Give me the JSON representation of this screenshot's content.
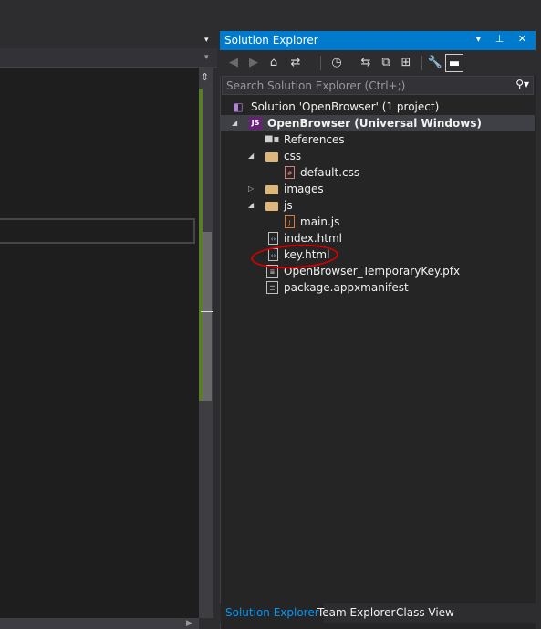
{
  "editor": {
    "top_dropdown_arrow": "▾",
    "nav_dropdown_arrow": "▾",
    "split_handle_glyph": "⇕",
    "hscroll_arrow": "▶"
  },
  "solution_explorer": {
    "title": "Solution Explorer",
    "title_buttons": "▾ ⊥ ✕",
    "toolbar": {
      "back": "◀",
      "forward": "▶",
      "home": "⌂",
      "sync": "⇄",
      "pending": "◷",
      "refresh": "⇆",
      "collapse": "⧉",
      "show_all": "⊞",
      "properties": "🔧",
      "preview": "▬"
    },
    "search": {
      "placeholder": "Search Solution Explorer (Ctrl+;)",
      "icon": "⚲▾"
    },
    "tree": {
      "solution": "Solution 'OpenBrowser' (1 project)",
      "project": "OpenBrowser (Universal Windows)",
      "project_icon_text": "JS",
      "references": "References",
      "css_folder": "css",
      "default_css": "default.css",
      "images_folder": "images",
      "js_folder": "js",
      "main_js": "main.js",
      "index_html": "index.html",
      "key_html": "key.html",
      "temp_key": "OpenBrowser_TemporaryKey.pfx",
      "manifest": "package.appxmanifest"
    },
    "tabs": {
      "solution_explorer": "Solution Explorer",
      "team_explorer": "Team Explorer",
      "class_view": "Class View"
    }
  },
  "colors": {
    "accent": "#007acc",
    "annotation_circle": "#d20000",
    "scroll_change_marker": "#5a7d29"
  }
}
